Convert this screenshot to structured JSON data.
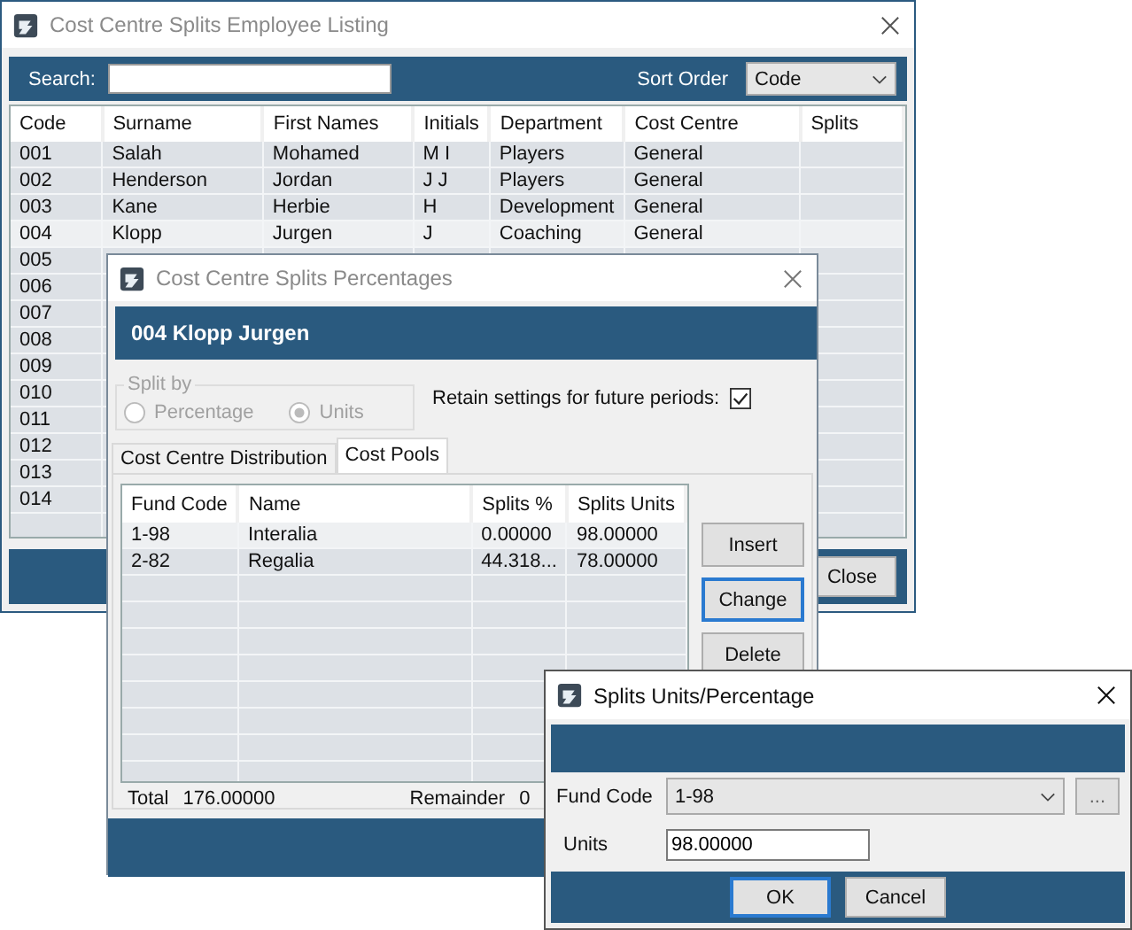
{
  "main_window": {
    "title": "Cost Centre Splits Employee Listing",
    "search": {
      "label": "Search:"
    },
    "sort_order": {
      "label": "Sort Order",
      "value": "Code"
    },
    "columns": [
      "Code",
      "Surname",
      "First Names",
      "Initials",
      "Department",
      "Cost Centre",
      "Splits"
    ],
    "rows": [
      {
        "cells": [
          "001",
          "Salah",
          "Mohamed",
          "M I",
          "Players",
          "General"
        ],
        "selected": false
      },
      {
        "cells": [
          "002",
          "Henderson",
          "Jordan",
          "J J",
          "Players",
          "General"
        ],
        "selected": false
      },
      {
        "cells": [
          "003",
          "Kane",
          "Herbie",
          "H",
          "Development",
          "General"
        ],
        "selected": false
      },
      {
        "cells": [
          "004",
          "Klopp",
          "Jurgen",
          "J",
          "Coaching",
          "General"
        ],
        "selected": true
      },
      {
        "cells": [
          "005"
        ],
        "selected": false
      },
      {
        "cells": [
          "006"
        ],
        "selected": false
      },
      {
        "cells": [
          "007"
        ],
        "selected": false
      },
      {
        "cells": [
          "008"
        ],
        "selected": false
      },
      {
        "cells": [
          "009"
        ],
        "selected": false
      },
      {
        "cells": [
          "010"
        ],
        "selected": false
      },
      {
        "cells": [
          "011"
        ],
        "selected": false
      },
      {
        "cells": [
          "012"
        ],
        "selected": false
      },
      {
        "cells": [
          "013"
        ],
        "selected": false
      },
      {
        "cells": [
          "014"
        ],
        "selected": false
      }
    ],
    "close_button": "Close"
  },
  "percentages_dialog": {
    "title": "Cost Centre Splits Percentages",
    "header": "004 Klopp Jurgen",
    "split_by": {
      "label": "Split by",
      "disabled": true,
      "options": [
        {
          "label": "Percentage",
          "selected": false
        },
        {
          "label": "Units",
          "selected": true
        }
      ]
    },
    "retain": {
      "label": "Retain settings for future periods:",
      "checked": true
    },
    "tabs": [
      {
        "label": "Cost Centre Distribution",
        "selected": false
      },
      {
        "label": "Cost Pools",
        "selected": true
      }
    ],
    "columns": [
      "Fund Code",
      "Name",
      "Splits %",
      "Splits Units"
    ],
    "rows": [
      {
        "cells": [
          "1-98",
          "Interalia",
          "0.00000",
          "98.00000"
        ],
        "selected": true
      },
      {
        "cells": [
          "2-82",
          "Regalia",
          "44.318...",
          "78.00000"
        ],
        "selected": false
      }
    ],
    "buttons": [
      {
        "label": "Insert",
        "focused": false
      },
      {
        "label": "Change",
        "focused": true
      },
      {
        "label": "Delete",
        "focused": false
      }
    ],
    "total": {
      "label": "Total",
      "value": "176.00000"
    },
    "remainder": {
      "label": "Remainder",
      "value": "0"
    }
  },
  "units_dialog": {
    "title": "Splits Units/Percentage",
    "fund_code": {
      "label": "Fund Code",
      "value": "1-98"
    },
    "browse_button": "...",
    "units": {
      "label": "Units",
      "value": "98.00000"
    },
    "buttons": [
      {
        "label": "OK",
        "focused": true
      },
      {
        "label": "Cancel",
        "focused": false
      }
    ]
  }
}
